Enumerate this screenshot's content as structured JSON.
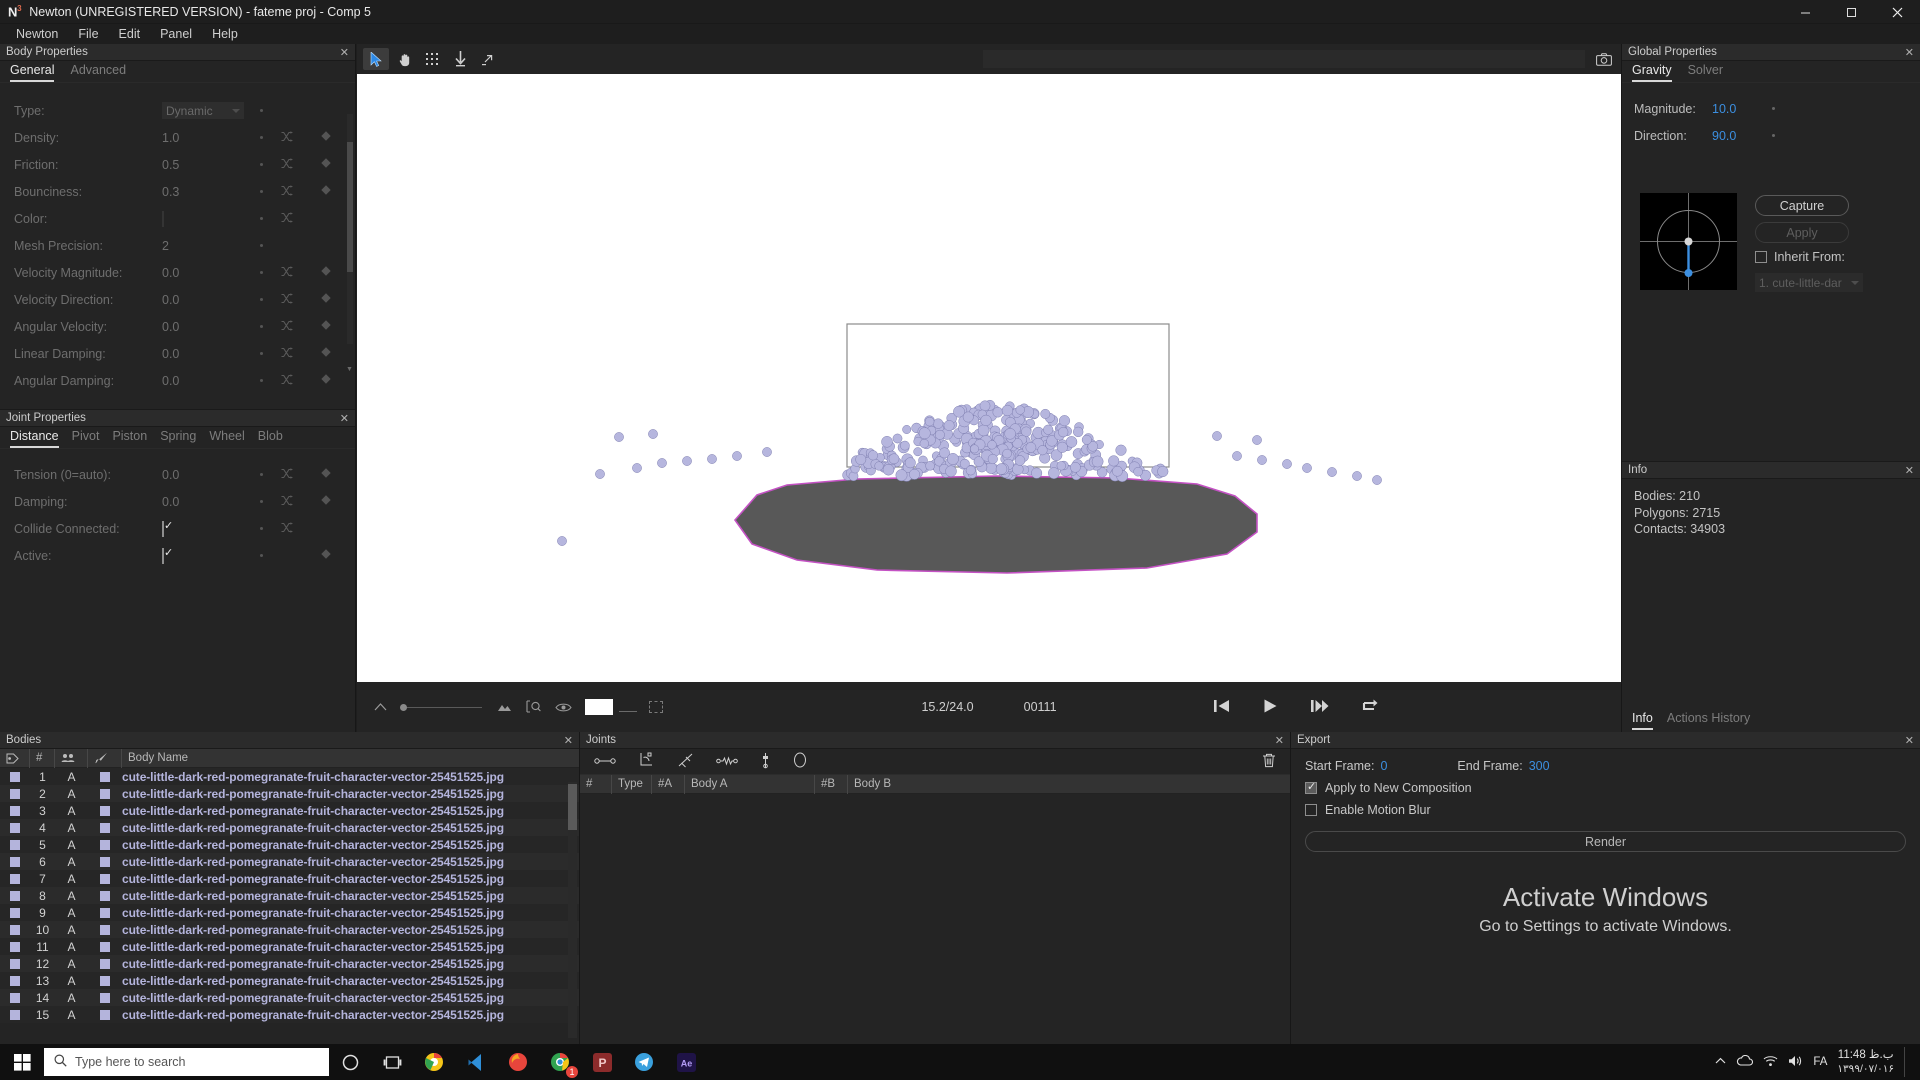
{
  "window": {
    "logo": "N",
    "logo_sup": "3",
    "title": "Newton (UNREGISTERED VERSION) - fateme proj - Comp 5",
    "minimize": "minimize-icon",
    "maximize": "maximize-icon",
    "close": "close-icon"
  },
  "menubar": {
    "items": [
      "Newton",
      "File",
      "Edit",
      "Panel",
      "Help"
    ]
  },
  "body_properties": {
    "title": "Body Properties",
    "close": "✕",
    "tabs": [
      {
        "label": "General",
        "active": true
      },
      {
        "label": "Advanced",
        "active": false
      }
    ],
    "rows": [
      {
        "label": "Type:",
        "value": "Dynamic",
        "kind": "select"
      },
      {
        "label": "Density:",
        "value": "1.0",
        "kind": "text",
        "rand": true,
        "key": true
      },
      {
        "label": "Friction:",
        "value": "0.5",
        "kind": "text",
        "rand": true,
        "key": true
      },
      {
        "label": "Bounciness:",
        "value": "0.3",
        "kind": "text",
        "rand": true,
        "key": true
      },
      {
        "label": "Color:",
        "value": "",
        "kind": "swatch",
        "rand": true,
        "key": false
      },
      {
        "label": "Mesh Precision:",
        "value": "2",
        "kind": "text",
        "rand": false,
        "key": false
      },
      {
        "label": "Velocity Magnitude:",
        "value": "0.0",
        "kind": "text",
        "rand": true,
        "key": true
      },
      {
        "label": "Velocity Direction:",
        "value": "0.0",
        "kind": "text",
        "rand": true,
        "key": true
      },
      {
        "label": "Angular Velocity:",
        "value": "0.0",
        "kind": "text",
        "rand": true,
        "key": true
      },
      {
        "label": "Linear Damping:",
        "value": "0.0",
        "kind": "text",
        "rand": true,
        "key": true
      },
      {
        "label": "Angular Damping:",
        "value": "0.0",
        "kind": "text",
        "rand": true,
        "key": true
      }
    ]
  },
  "joint_properties": {
    "title": "Joint Properties",
    "close": "✕",
    "tabs": [
      {
        "label": "Distance",
        "active": true
      },
      {
        "label": "Pivot",
        "active": false
      },
      {
        "label": "Piston",
        "active": false
      },
      {
        "label": "Spring",
        "active": false
      },
      {
        "label": "Wheel",
        "active": false
      },
      {
        "label": "Blob",
        "active": false
      }
    ],
    "rows": [
      {
        "label": "Tension (0=auto):",
        "value": "0.0",
        "kind": "text",
        "rand": true,
        "key": true
      },
      {
        "label": "Damping:",
        "value": "0.0",
        "kind": "text",
        "rand": true,
        "key": true
      },
      {
        "label": "Collide Connected:",
        "value": "",
        "kind": "checkbox",
        "checked": true,
        "rand": true,
        "key": false
      },
      {
        "label": "Active:",
        "value": "",
        "kind": "checkbox",
        "checked": true,
        "rand": false,
        "key": true
      }
    ]
  },
  "viewer": {
    "tools": [
      {
        "name": "select-arrow-tool",
        "active": true
      },
      {
        "name": "pan-hand-tool",
        "active": false
      },
      {
        "name": "marquee-select-tool",
        "active": false
      },
      {
        "name": "gravity-arrow-tool",
        "active": false
      },
      {
        "name": "expand-view-tool",
        "active": false
      }
    ],
    "search_placeholder": "",
    "camera_icon": "camera-icon",
    "timeline": {
      "speed_icon": "playback-speed-icon",
      "zoom_icon": "zoom-fit-icon",
      "eye_icon": "visibility-icon",
      "mountains_icon": "background-icon",
      "time_current": "15.2/24.0",
      "frame_current": "00111",
      "transport": [
        {
          "name": "go-to-start-button",
          "glyph": "first"
        },
        {
          "name": "play-button",
          "glyph": "play"
        },
        {
          "name": "step-forward-button",
          "glyph": "step"
        },
        {
          "name": "loop-button",
          "glyph": "loop"
        }
      ]
    }
  },
  "global_properties": {
    "title": "Global Properties",
    "close": "✕",
    "tabs": [
      {
        "label": "Gravity",
        "active": true
      },
      {
        "label": "Solver",
        "active": false
      }
    ],
    "magnitude_label": "Magnitude:",
    "magnitude_value": "10.0",
    "direction_label": "Direction:",
    "direction_value": "90.0",
    "capture_button": "Capture",
    "apply_button": "Apply",
    "inherit_label": "Inherit From:",
    "inherit_checked": false,
    "inherit_value": "1. cute-little-dar",
    "accent_color": "#3c8fe0"
  },
  "info_panel": {
    "title": "Info",
    "close": "✕",
    "lines": [
      "Bodies: 210",
      "Polygons: 2715",
      "Contacts: 34903"
    ],
    "footer_tabs": [
      {
        "label": "Info",
        "active": true
      },
      {
        "label": "Actions History",
        "active": false
      }
    ]
  },
  "bodies_panel": {
    "title": "Bodies",
    "close": "✕",
    "columns": [
      "tag-icon",
      "#",
      "group-icon",
      "brush-icon",
      "Body Name"
    ],
    "body_name_header": "Body Name",
    "hash_header": "#",
    "rows": [
      {
        "num": "1",
        "group": "A",
        "name": "cute-little-dark-red-pomegranate-fruit-character-vector-25451525.jpg"
      },
      {
        "num": "2",
        "group": "A",
        "name": "cute-little-dark-red-pomegranate-fruit-character-vector-25451525.jpg"
      },
      {
        "num": "3",
        "group": "A",
        "name": "cute-little-dark-red-pomegranate-fruit-character-vector-25451525.jpg"
      },
      {
        "num": "4",
        "group": "A",
        "name": "cute-little-dark-red-pomegranate-fruit-character-vector-25451525.jpg"
      },
      {
        "num": "5",
        "group": "A",
        "name": "cute-little-dark-red-pomegranate-fruit-character-vector-25451525.jpg"
      },
      {
        "num": "6",
        "group": "A",
        "name": "cute-little-dark-red-pomegranate-fruit-character-vector-25451525.jpg"
      },
      {
        "num": "7",
        "group": "A",
        "name": "cute-little-dark-red-pomegranate-fruit-character-vector-25451525.jpg"
      },
      {
        "num": "8",
        "group": "A",
        "name": "cute-little-dark-red-pomegranate-fruit-character-vector-25451525.jpg"
      },
      {
        "num": "9",
        "group": "A",
        "name": "cute-little-dark-red-pomegranate-fruit-character-vector-25451525.jpg"
      },
      {
        "num": "10",
        "group": "A",
        "name": "cute-little-dark-red-pomegranate-fruit-character-vector-25451525.jpg"
      },
      {
        "num": "11",
        "group": "A",
        "name": "cute-little-dark-red-pomegranate-fruit-character-vector-25451525.jpg"
      },
      {
        "num": "12",
        "group": "A",
        "name": "cute-little-dark-red-pomegranate-fruit-character-vector-25451525.jpg"
      },
      {
        "num": "13",
        "group": "A",
        "name": "cute-little-dark-red-pomegranate-fruit-character-vector-25451525.jpg"
      },
      {
        "num": "14",
        "group": "A",
        "name": "cute-little-dark-red-pomegranate-fruit-character-vector-25451525.jpg"
      },
      {
        "num": "15",
        "group": "A",
        "name": "cute-little-dark-red-pomegranate-fruit-character-vector-25451525.jpg"
      }
    ]
  },
  "joints_panel": {
    "title": "Joints",
    "close": "✕",
    "tools": [
      {
        "name": "distance-joint-tool"
      },
      {
        "name": "pivot-joint-tool"
      },
      {
        "name": "piston-joint-tool"
      },
      {
        "name": "spring-joint-tool"
      },
      {
        "name": "wheel-joint-tool"
      },
      {
        "name": "blob-joint-tool"
      }
    ],
    "delete_icon": "trash-icon",
    "columns": [
      "#",
      "Type",
      "#A",
      "Body A",
      "#B",
      "Body B"
    ]
  },
  "export_panel": {
    "title": "Export",
    "close": "✕",
    "start_frame_label": "Start Frame:",
    "start_frame_value": "0",
    "end_frame_label": "End Frame:",
    "end_frame_value": "300",
    "apply_new_comp_label": "Apply to New Composition",
    "apply_new_comp_checked": true,
    "motion_blur_label": "Enable Motion Blur",
    "motion_blur_checked": false,
    "render_button": "Render"
  },
  "watermark": {
    "line1": "Activate Windows",
    "line2": "Go to Settings to activate Windows."
  },
  "taskbar": {
    "start_icon": "windows-start-icon",
    "search_placeholder": "Type here to search",
    "search_icon": "search-icon",
    "items": [
      {
        "name": "cortana-icon"
      },
      {
        "name": "task-view-icon"
      },
      {
        "name": "chrome-alt-icon"
      },
      {
        "name": "vscode-icon"
      },
      {
        "name": "firefox-icon"
      },
      {
        "name": "chrome-icon",
        "badge": "1"
      },
      {
        "name": "photoshop-icon"
      },
      {
        "name": "telegram-icon"
      },
      {
        "name": "after-effects-icon"
      }
    ],
    "tray": {
      "chevron": "show-hidden-icons",
      "onedrive": "onedrive-icon",
      "network": "network-icon",
      "volume": "volume-icon",
      "lang": "FA",
      "time": "11:48 ب.ظ",
      "date": "۱۳۹۹/۰۷/۰۱۶"
    }
  }
}
